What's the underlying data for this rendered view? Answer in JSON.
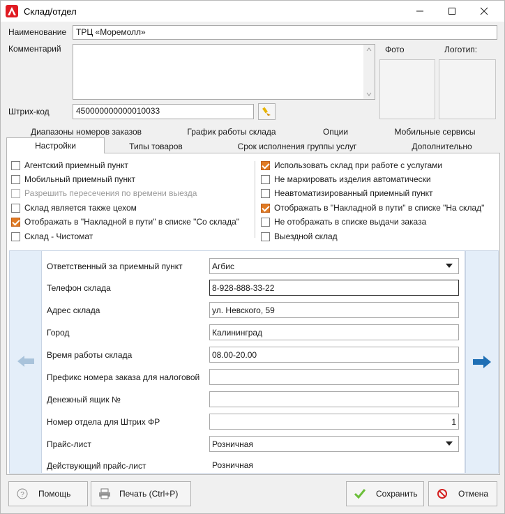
{
  "window": {
    "title": "Склад/отдел"
  },
  "colors": {
    "accent": "#e07a23",
    "brand": "#e01b22",
    "nav_bg": "#e4eef9",
    "arrow_right": "#1f6fb5",
    "arrow_left": "#a9c3db"
  },
  "header": {
    "name_label": "Наименование",
    "name_value": "ТРЦ «Моремолл»",
    "comment_label": "Комментарий",
    "comment_value": "",
    "barcode_label": "Штрих-код",
    "barcode_value": "450000000000010033",
    "photo_label": "Фото",
    "logo_label": "Логотип:"
  },
  "tabs_row1": [
    "Диапазоны номеров заказов",
    "График работы склада",
    "Опции",
    "Мобильные сервисы"
  ],
  "tabs_row2": [
    "Настройки",
    "Типы товаров",
    "Срок исполнения группы услуг",
    "Дополнительно"
  ],
  "active_tab": "Настройки",
  "checkboxes_left": [
    {
      "label": "Агентский приемный пункт",
      "checked": false,
      "disabled": false
    },
    {
      "label": "Мобильный приемный пункт",
      "checked": false,
      "disabled": false
    },
    {
      "label": "Разрешить пересечения по времени выезда",
      "checked": false,
      "disabled": true
    },
    {
      "label": "Склад является также цехом",
      "checked": false,
      "disabled": false
    },
    {
      "label": "Отображать в \"Накладной в пути\" в списке \"Со склада\"",
      "checked": true,
      "disabled": false
    },
    {
      "label": "Склад - Чистомат",
      "checked": false,
      "disabled": false
    }
  ],
  "checkboxes_right": [
    {
      "label": "Использовать склад при работе с услугами",
      "checked": true,
      "disabled": false
    },
    {
      "label": "Не маркировать изделия автоматически",
      "checked": false,
      "disabled": false
    },
    {
      "label": "Неавтоматизированный приемный пункт",
      "checked": false,
      "disabled": false
    },
    {
      "label": "Отображать в \"Накладной в пути\" в списке \"На склад\"",
      "checked": true,
      "disabled": false
    },
    {
      "label": "Не отображать в списке выдачи заказа",
      "checked": false,
      "disabled": false
    },
    {
      "label": "Выездной склад",
      "checked": false,
      "disabled": false
    }
  ],
  "form": {
    "responsible_label": "Ответственный за приемный пункт",
    "responsible_value": "Агбис",
    "phone_label": "Телефон склада",
    "phone_value": "8-928-888-33-22",
    "address_label": "Адрес склада",
    "address_value": "ул. Невского, 59",
    "city_label": "Город",
    "city_value": "Калининград",
    "hours_label": "Время работы склада",
    "hours_value": "08.00-20.00",
    "prefix_label": "Префикс номера заказа для налоговой",
    "prefix_value": "",
    "cashbox_label": "Денежный ящик №",
    "cashbox_value": "",
    "dept_label": "Номер отдела для Штрих ФР",
    "dept_value": "1",
    "pricelist_label": "Прайс-лист",
    "pricelist_value": "Розничная",
    "active_pricelist_label": "Действующий прайс-лист",
    "active_pricelist_value": "Розничная"
  },
  "buttons": {
    "help": "Помощь",
    "print": "Печать (Ctrl+P)",
    "save": "Сохранить",
    "cancel": "Отмена"
  }
}
